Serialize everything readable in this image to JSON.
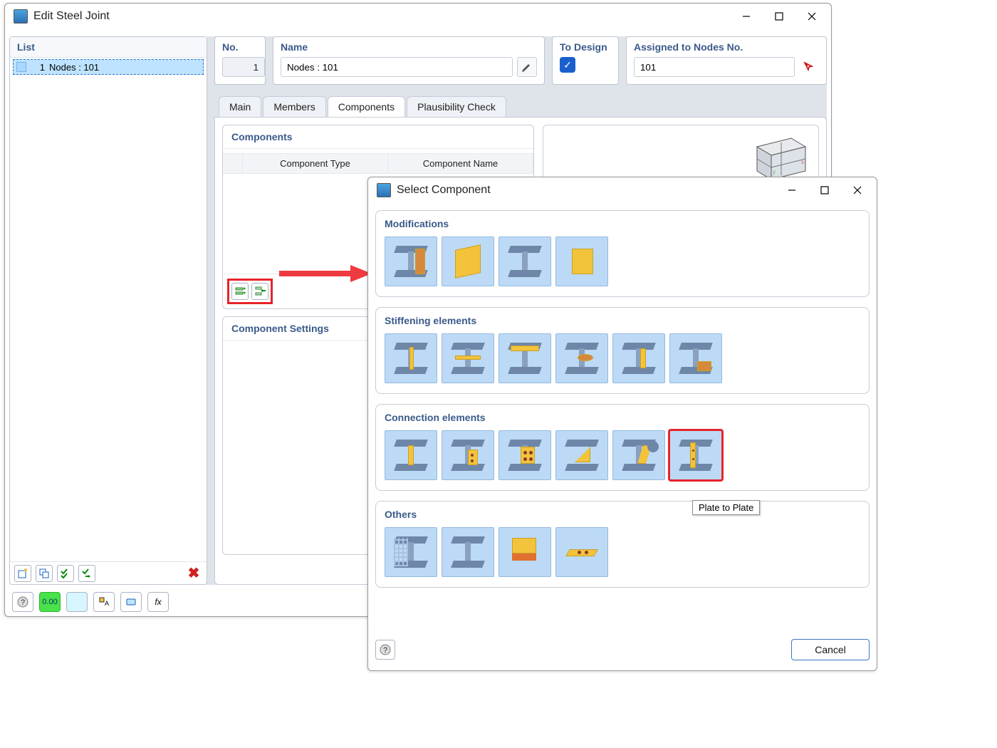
{
  "mainWindow": {
    "title": "Edit Steel Joint",
    "listPanel": {
      "heading": "List",
      "items": [
        {
          "index": "1",
          "label": "Nodes : 101"
        }
      ]
    },
    "fields": {
      "no": {
        "label": "No.",
        "value": "1"
      },
      "name": {
        "label": "Name",
        "value": "Nodes : 101"
      },
      "toDesign": {
        "label": "To Design",
        "checked": true
      },
      "assigned": {
        "label": "Assigned to Nodes No.",
        "value": "101"
      }
    },
    "tabs": [
      "Main",
      "Members",
      "Components",
      "Plausibility Check"
    ],
    "activeTab": 2,
    "componentsCard": {
      "title": "Components",
      "columns": [
        "Component Type",
        "Component Name"
      ]
    },
    "settingsCard": {
      "title": "Component Settings"
    }
  },
  "dialog": {
    "title": "Select Component",
    "categories": [
      {
        "title": "Modifications",
        "count": 4
      },
      {
        "title": "Stiffening elements",
        "count": 6
      },
      {
        "title": "Connection elements",
        "count": 6,
        "selectedIndex": 5
      },
      {
        "title": "Others",
        "count": 4
      }
    ],
    "tooltip": "Plate to Plate",
    "cancel": "Cancel"
  }
}
